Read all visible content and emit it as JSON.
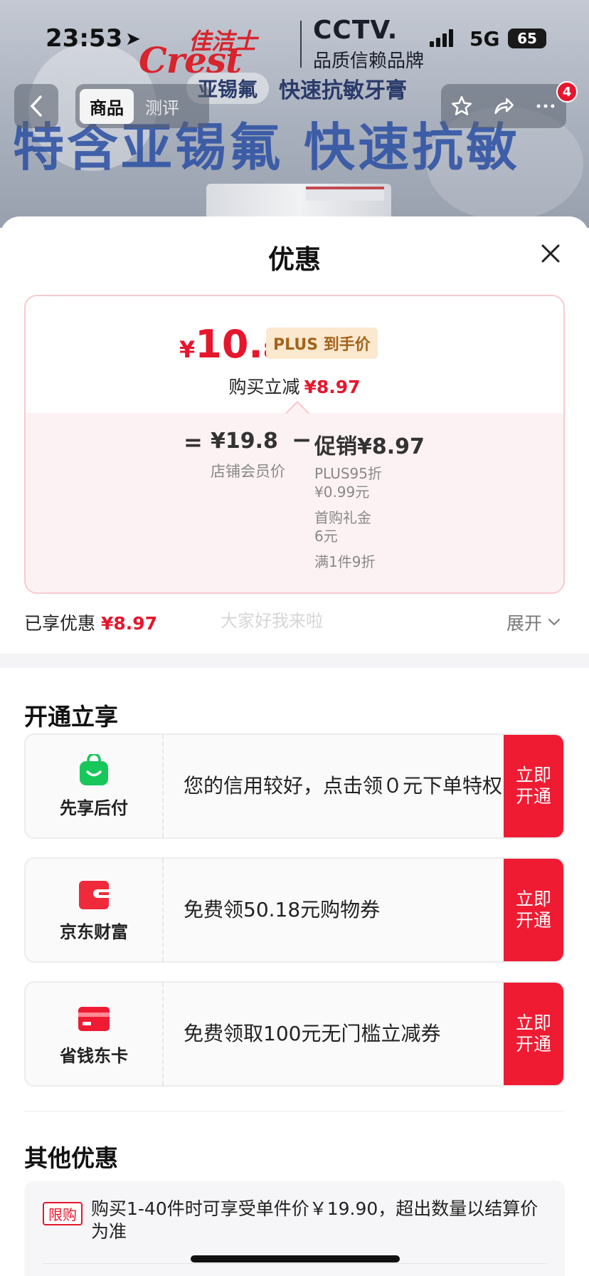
{
  "status_bar": {
    "time": "23:53",
    "network": "5G",
    "battery": "65"
  },
  "banner": {
    "brand_cn": "佳洁士",
    "brand_en": "Crest",
    "cctv": "CCTV.",
    "cctv_sub": "品质信赖品牌",
    "sub_pill": "亚锡氟",
    "sub_text": "快速抗敏牙膏",
    "headline": "特含亚锡氟 快速抗敏"
  },
  "nav": {
    "tabs": [
      {
        "label": "商品"
      },
      {
        "label": "测评"
      }
    ],
    "cart_badge": "4"
  },
  "sheet": {
    "title": "优惠",
    "final_price": {
      "currency": "¥",
      "integer": "10.",
      "decimal": "83"
    },
    "plus_tag": "PLUS 到手价",
    "reduce_label": "购买立减",
    "reduce_value": "¥8.97",
    "breakdown": {
      "eq": "=",
      "member_price": "¥19.8",
      "member_label": "店铺会员价",
      "minus": "−",
      "promo": "促销¥8.97",
      "promo_lines": [
        {
          "line1": "PLUS95折",
          "line2": "¥0.99元"
        },
        {
          "line1": "首购礼金",
          "line2": "6元"
        },
        {
          "line1": "满1件9折",
          "line2": ""
        }
      ]
    },
    "enjoyed_label": "已享优惠",
    "enjoyed_value": "¥8.97",
    "watermark": "大家好我来啦",
    "expand_label": "展开",
    "open_section_title": "开通立享",
    "services": [
      {
        "name": "先享后付",
        "desc": "您的信用较好，点击领０元下单特权",
        "cta": "立即开通",
        "icon": "shopping-bag-icon",
        "color": "#17c75a"
      },
      {
        "name": "京东财富",
        "desc": "免费领50.18元购物券",
        "cta": "立即开通",
        "icon": "wallet-icon",
        "color": "#ef2a3a"
      },
      {
        "name": "省钱东卡",
        "desc": "免费领取100元无门槛立减券",
        "cta": "立即开通",
        "icon": "card-icon",
        "color": "#ef1b32"
      }
    ],
    "other_section_title": "其他优惠",
    "other": {
      "tag": "限购",
      "text": "购买1-40件时可享受单件价￥19.90，超出数量以结算价为准"
    }
  }
}
